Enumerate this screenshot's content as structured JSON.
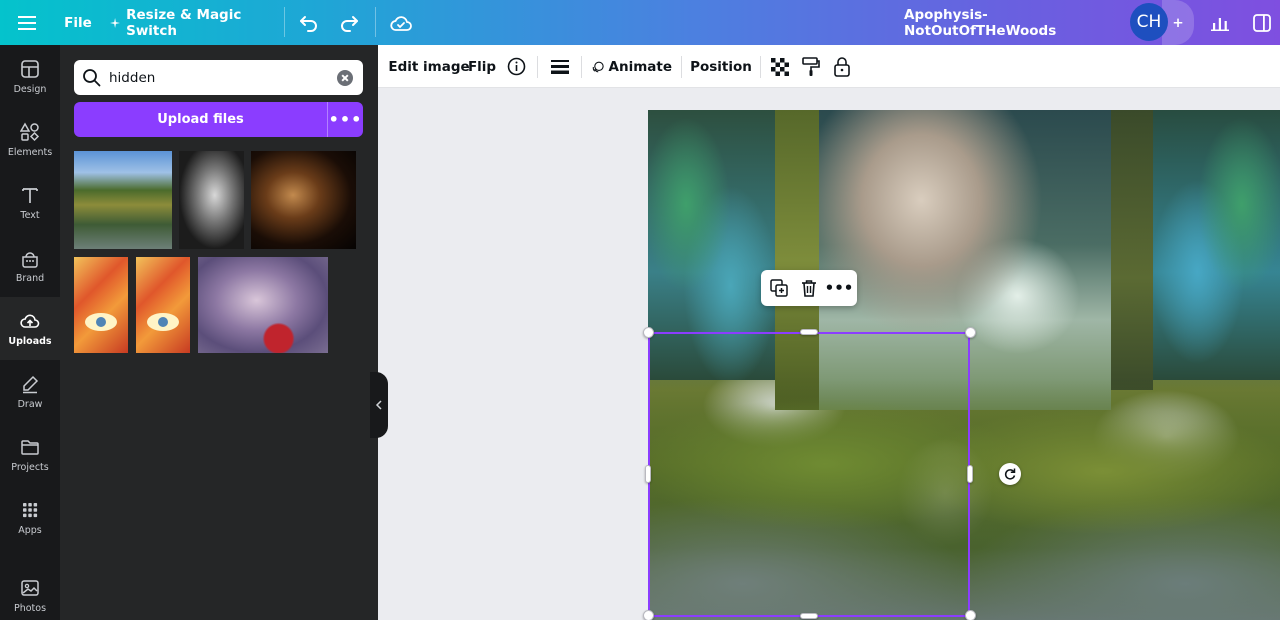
{
  "topbar": {
    "file_label": "File",
    "resize_label": "Resize & Magic Switch",
    "design_title": "Apophysis-NotOutOfTHeWoods",
    "avatar_initials": "CH"
  },
  "rail": {
    "items": [
      {
        "label": "Design",
        "icon": "design-icon"
      },
      {
        "label": "Elements",
        "icon": "elements-icon"
      },
      {
        "label": "Text",
        "icon": "text-icon"
      },
      {
        "label": "Brand",
        "icon": "brand-icon"
      },
      {
        "label": "Uploads",
        "icon": "upload-cloud-icon",
        "active": true
      },
      {
        "label": "Draw",
        "icon": "draw-icon"
      },
      {
        "label": "Projects",
        "icon": "folder-icon"
      },
      {
        "label": "Apps",
        "icon": "apps-grid-icon"
      },
      {
        "label": "Photos",
        "icon": "photo-icon"
      }
    ]
  },
  "panel": {
    "search_value": "hidden",
    "upload_label": "Upload files",
    "more_label": "•••"
  },
  "toolbar": {
    "edit_image": "Edit image",
    "flip": "Flip",
    "animate": "Animate",
    "position": "Position"
  },
  "floating_toolbar": {
    "more_label": "•••"
  },
  "colors": {
    "accent": "#8b3dff",
    "rail_bg": "#18191b",
    "panel_bg": "#252627",
    "avatar_bg": "#1e4fbf"
  }
}
